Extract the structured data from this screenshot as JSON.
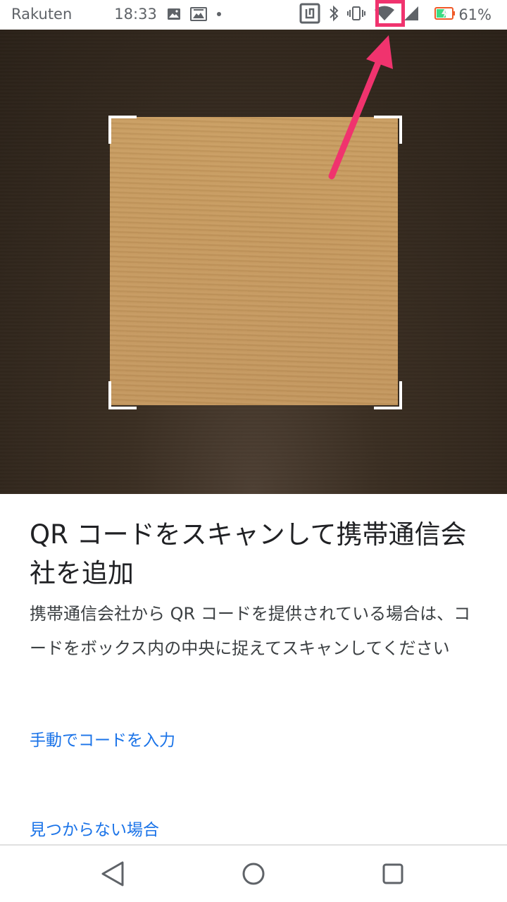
{
  "status_bar": {
    "carrier": "Rakuten",
    "time": "18:33",
    "battery_percent": "61%",
    "icons": [
      "image-icon",
      "gallery-icon",
      "dot-icon",
      "nfc-icon",
      "bluetooth-icon",
      "vibrate-icon",
      "wifi-icon",
      "cell-signal-icon",
      "battery-charging-icon"
    ]
  },
  "scanner": {
    "title": "QR コードをスキャンして携帯通信会社を追加",
    "description": "携帯通信会社から QR コードを提供されている場合は、コードをボックス内の中央に捉えてスキャンしてください",
    "manual_entry_link": "手動でコードを入力",
    "not_found_link": "見つからない場合"
  },
  "nav_bar": {
    "buttons": [
      "back",
      "home",
      "recents"
    ]
  },
  "colors": {
    "link": "#1a73e8",
    "annotation": "#f0336e",
    "battery_fill": "#3ddc84",
    "battery_outline": "#f05a28"
  }
}
